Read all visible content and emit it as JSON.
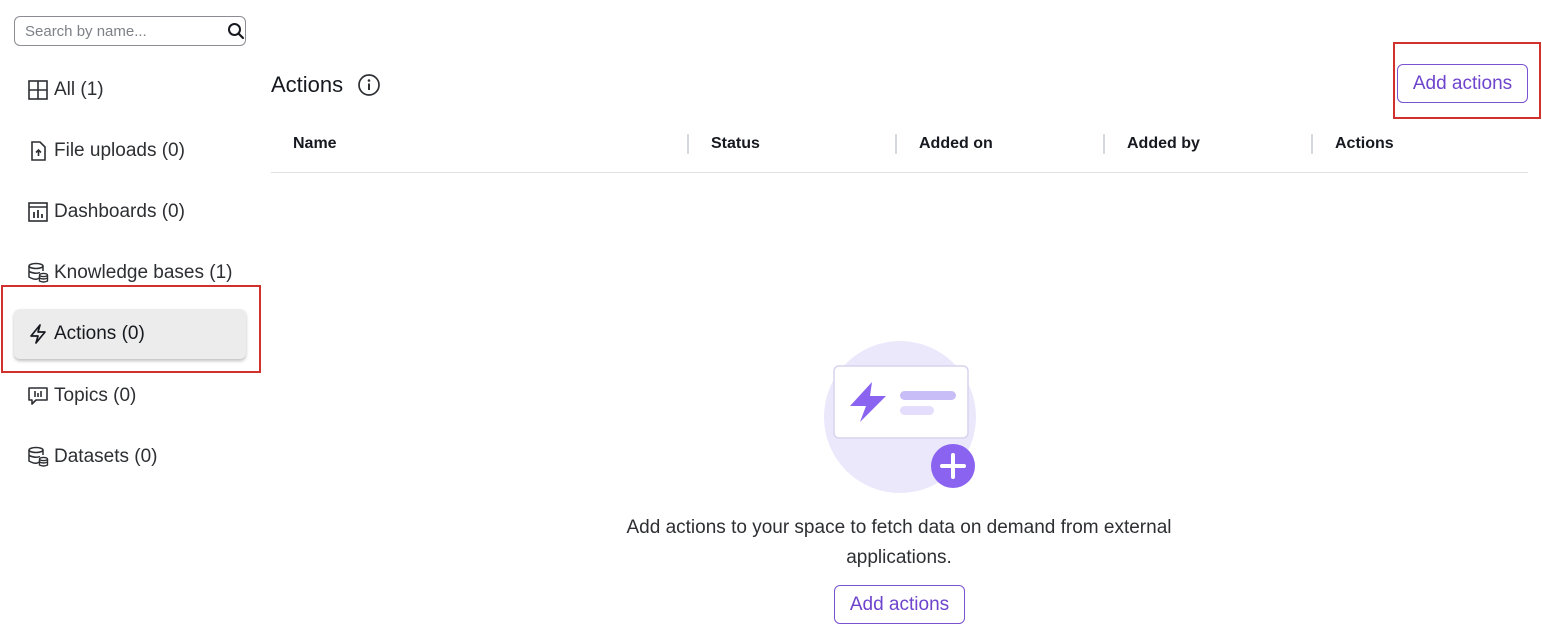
{
  "search": {
    "placeholder": "Search by name...",
    "value": ""
  },
  "sidebar": {
    "items": [
      {
        "label": "All (1)",
        "icon": "grid-icon"
      },
      {
        "label": "File uploads (0)",
        "icon": "file-upload-icon"
      },
      {
        "label": "Dashboards (0)",
        "icon": "dashboard-icon"
      },
      {
        "label": "Knowledge bases (1)",
        "icon": "database-icon"
      },
      {
        "label": "Actions (0)",
        "icon": "lightning-icon",
        "active": true
      },
      {
        "label": "Topics (0)",
        "icon": "topic-chat-icon"
      },
      {
        "label": "Datasets (0)",
        "icon": "database-icon"
      }
    ]
  },
  "main": {
    "title": "Actions",
    "add_button_label": "Add actions",
    "columns": [
      "Name",
      "Status",
      "Added on",
      "Added by",
      "Actions"
    ],
    "empty_state": {
      "message": "Add actions to your space to fetch data on demand from external applications.",
      "button_label": "Add actions"
    }
  },
  "colors": {
    "accent": "#6e44cc",
    "highlight": "#d0312d",
    "active_bg": "#ececec"
  }
}
